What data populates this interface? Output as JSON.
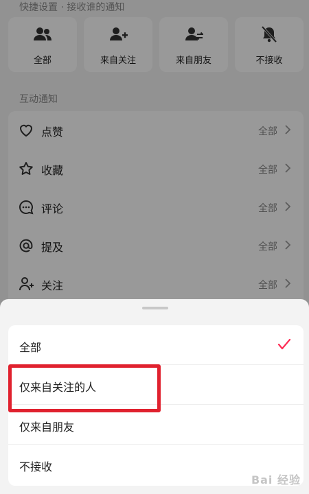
{
  "quick_settings": {
    "title": "快捷设置 · 接收谁的通知",
    "options": [
      {
        "label": "全部",
        "icon": "group-icon"
      },
      {
        "label": "来自关注",
        "icon": "user-plus-icon"
      },
      {
        "label": "来自朋友",
        "icon": "user-swap-icon"
      },
      {
        "label": "不接收",
        "icon": "bell-off-icon"
      }
    ]
  },
  "interaction": {
    "title": "互动通知",
    "items": [
      {
        "label": "点赞",
        "value": "全部",
        "icon": "heart-icon"
      },
      {
        "label": "收藏",
        "value": "全部",
        "icon": "star-icon"
      },
      {
        "label": "评论",
        "value": "全部",
        "icon": "comment-icon"
      },
      {
        "label": "提及",
        "value": "全部",
        "icon": "at-icon"
      },
      {
        "label": "关注",
        "value": "全部",
        "icon": "user-plus-icon"
      }
    ]
  },
  "sheet": {
    "options": [
      {
        "label": "全部",
        "selected": true
      },
      {
        "label": "仅来自关注的人",
        "selected": false
      },
      {
        "label": "仅来自朋友",
        "selected": false
      },
      {
        "label": "不接收",
        "selected": false
      }
    ]
  },
  "colors": {
    "accent": "#fe2c55",
    "highlight_box": "#e0212e"
  },
  "watermark": "Bai 经验"
}
